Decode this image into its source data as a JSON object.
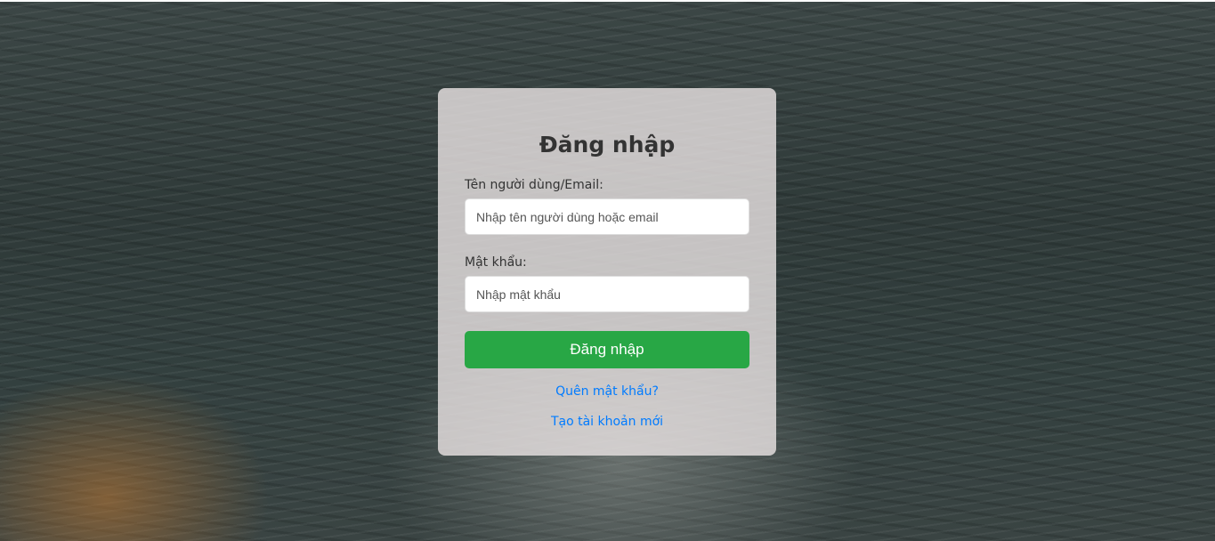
{
  "login": {
    "title": "Đăng nhập",
    "username_label": "Tên người dùng/Email:",
    "username_placeholder": "Nhập tên người dùng hoặc email",
    "username_value": "",
    "password_label": "Mật khẩu:",
    "password_placeholder": "Nhập mật khẩu",
    "password_value": "",
    "submit_label": "Đăng nhập",
    "forgot_link": "Quên mật khẩu?",
    "register_link": "Tạo tài khoản mới"
  },
  "colors": {
    "primary_button": "#28a745",
    "link": "#007bff",
    "card_background": "rgba(232,226,226,0.82)"
  }
}
